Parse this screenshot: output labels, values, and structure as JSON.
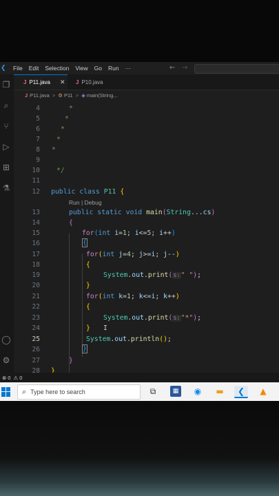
{
  "menu": {
    "items": [
      "File",
      "Edit",
      "Selection",
      "View",
      "Go",
      "Run",
      "···"
    ]
  },
  "tabs": [
    {
      "icon": "J",
      "label": "P11.java",
      "active": true
    },
    {
      "icon": "J",
      "label": "P10.java",
      "active": false
    }
  ],
  "breadcrumb": {
    "file": "P11.java",
    "cls": "P11",
    "method": "main(String...",
    "sep": ">"
  },
  "editor": {
    "codelens": "Run | Debug",
    "line_numbers": [
      "4",
      "5",
      "6",
      "7",
      "8",
      "9",
      "10",
      "11",
      "12",
      "13",
      "14",
      "15",
      "16",
      "17",
      "18",
      "19",
      "20",
      "21",
      "22",
      "23",
      "24",
      "25",
      "26",
      "27",
      "28"
    ],
    "comment_star": "*",
    "comment_end": "*/",
    "kw_public": "public",
    "kw_class": "class",
    "class_name": "P11",
    "kw_static": "static",
    "kw_void": "void",
    "method_name": "main",
    "param_type": "String",
    "param_rest": "...cs",
    "kw_for": "for",
    "kw_int": "int",
    "loop1": [
      "i",
      "1",
      "i",
      "5",
      "i"
    ],
    "loop2": [
      "j",
      "4",
      "j",
      "i",
      "j"
    ],
    "loop3": [
      "k",
      "1",
      "k",
      "i",
      "k"
    ],
    "sys": "System",
    "out": "out",
    "print": "print",
    "println": "println",
    "hint": "s:",
    "str_space": "\" \"",
    "str_star": "\"*\""
  },
  "statusbar": {
    "errors": "0",
    "warnings": "0"
  },
  "taskbar": {
    "search_placeholder": "Type here to search"
  },
  "colors": {
    "accent": "#0078d4",
    "editor_bg": "#1e1e1e"
  }
}
